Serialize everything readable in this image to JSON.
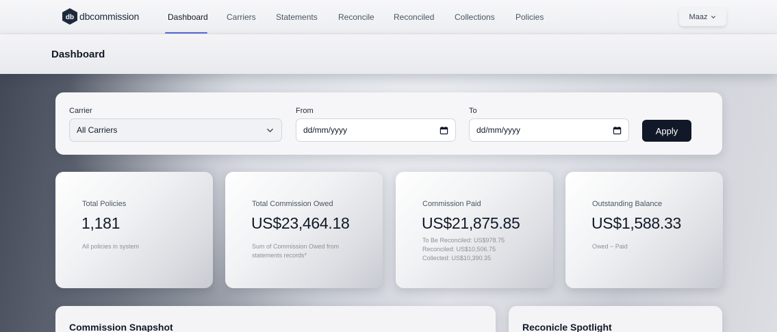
{
  "brand": {
    "name": "dbcommission",
    "mark": "db"
  },
  "nav": {
    "items": [
      {
        "label": "Dashboard",
        "active": true
      },
      {
        "label": "Carriers"
      },
      {
        "label": "Statements"
      },
      {
        "label": "Reconcile"
      },
      {
        "label": "Reconciled"
      },
      {
        "label": "Collections"
      },
      {
        "label": "Policies"
      }
    ],
    "user": "Maaz",
    "accent_color": "#5b6bd6"
  },
  "page": {
    "title": "Dashboard"
  },
  "filters": {
    "carrier_label": "Carrier",
    "carrier_value": "All Carriers",
    "from_label": "From",
    "from_placeholder": "dd/mm/yyyy",
    "to_label": "To",
    "to_placeholder": "dd/mm/yyyy",
    "apply_label": "Apply"
  },
  "stats": [
    {
      "label": "Total Policies",
      "value": "1,181",
      "sub": "All policies in system"
    },
    {
      "label": "Total Commission Owed",
      "value": "US$23,464.18",
      "sub": "Sum of Commission Owed from statements records*"
    },
    {
      "label": "Commission Paid",
      "value": "US$21,875.85",
      "lines": [
        "To Be Reconciled: US$978.75",
        "Reconciled: US$10,506.75",
        "Collected: US$10,390.35"
      ]
    },
    {
      "label": "Outstanding Balance",
      "value": "US$1,588.33",
      "sub": "Owed − Paid"
    }
  ],
  "sections": {
    "snapshot_title": "Commission Snapshot",
    "spotlight_title": "Reconicle Spotlight"
  }
}
